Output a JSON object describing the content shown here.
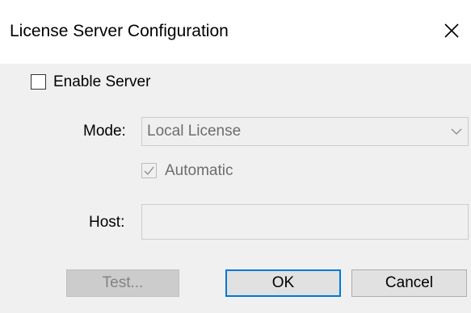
{
  "window": {
    "title": "License Server Configuration",
    "close_icon": "close-icon"
  },
  "enable_server": {
    "label": "Enable Server",
    "checked": false
  },
  "mode": {
    "label": "Mode:",
    "value": "Local License",
    "enabled": false
  },
  "automatic": {
    "label": "Automatic",
    "checked": true,
    "enabled": false
  },
  "host": {
    "label": "Host:",
    "value": "",
    "enabled": false
  },
  "buttons": {
    "test": "Test...",
    "ok": "OK",
    "cancel": "Cancel"
  },
  "colors": {
    "accent": "#0078d7",
    "disabled_text": "#6d6d6d",
    "background": "#f0f0f0"
  }
}
